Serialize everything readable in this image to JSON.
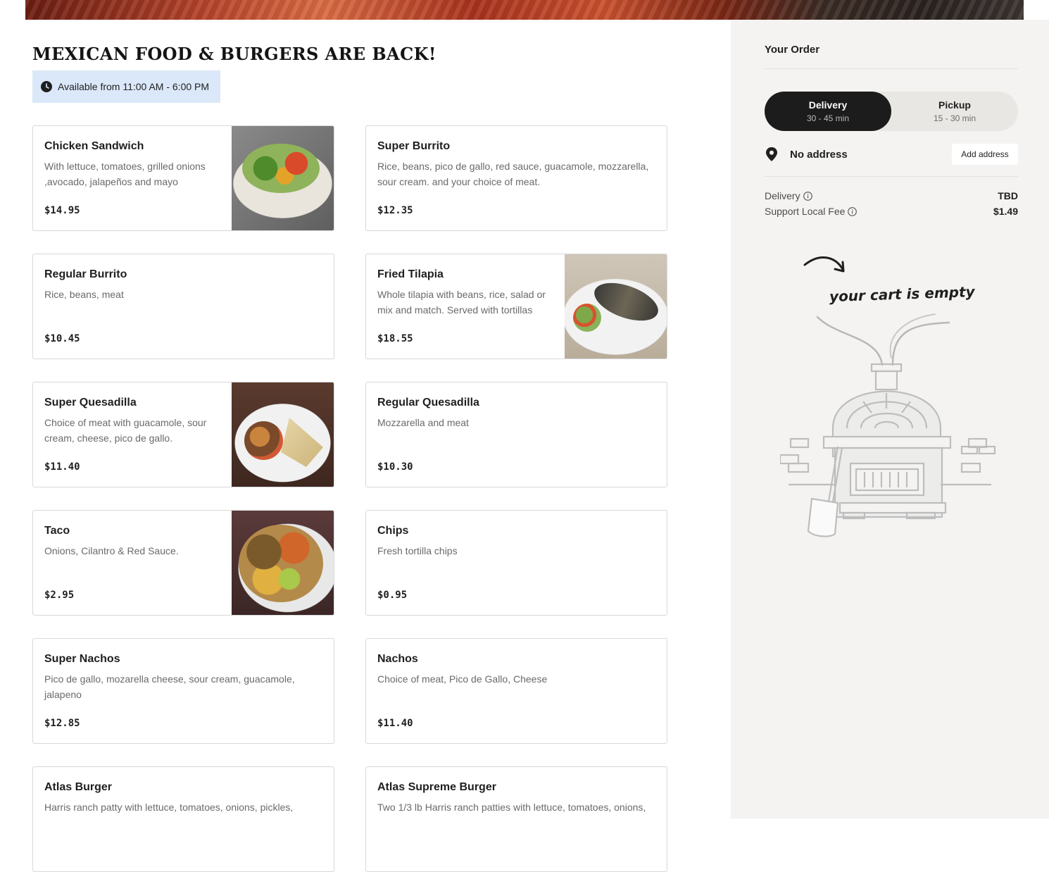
{
  "menu": {
    "title": "MEXICAN FOOD & BURGERS ARE BACK!",
    "availability": "Available from 11:00 AM - 6:00 PM",
    "items": [
      {
        "name": "Chicken Sandwich",
        "description": "With lettuce, tomatoes, grilled onions ,avocado, jalapeños and mayo",
        "price": "$14.95",
        "image": "chicken-sandwich-photo"
      },
      {
        "name": "Super Burrito",
        "description": "Rice, beans, pico de gallo, red sauce, guacamole, mozzarella, sour cream. and your choice of meat.",
        "price": "$12.35"
      },
      {
        "name": "Regular Burrito",
        "description": "Rice, beans, meat",
        "price": "$10.45"
      },
      {
        "name": "Fried Tilapia",
        "description": "Whole tilapia with beans, rice, salad or mix and match. Served with tortillas",
        "price": "$18.55",
        "image": "fried-tilapia-photo"
      },
      {
        "name": "Super Quesadilla",
        "description": "Choice of meat with guacamole, sour cream, cheese, pico de gallo.",
        "price": "$11.40",
        "image": "super-quesadilla-photo"
      },
      {
        "name": "Regular Quesadilla",
        "description": "Mozzarella and meat",
        "price": "$10.30"
      },
      {
        "name": "Taco",
        "description": "Onions, Cilantro & Red Sauce.",
        "price": "$2.95",
        "image": "taco-photo"
      },
      {
        "name": "Chips",
        "description": "Fresh tortilla chips",
        "price": "$0.95"
      },
      {
        "name": "Super Nachos",
        "description": "Pico de gallo, mozarella cheese, sour cream, guacamole, jalapeno",
        "price": "$12.85"
      },
      {
        "name": "Nachos",
        "description": "Choice of meat, Pico de Gallo, Cheese",
        "price": "$11.40"
      },
      {
        "name": "Atlas Burger",
        "description": "Harris ranch patty with lettuce, tomatoes, onions, pickles,",
        "price": ""
      },
      {
        "name": "Atlas Supreme Burger",
        "description": "Two 1/3 lb Harris ranch patties with lettuce, tomatoes, onions,",
        "price": ""
      }
    ]
  },
  "order": {
    "title": "Your Order",
    "delivery_option": {
      "label": "Delivery",
      "time": "30 - 45 min",
      "selected": true
    },
    "pickup_option": {
      "label": "Pickup",
      "time": "15 - 30 min",
      "selected": false
    },
    "address": {
      "text": "No address",
      "button": "Add address"
    },
    "fees": [
      {
        "label": "Delivery",
        "value": "TBD"
      },
      {
        "label": "Support Local Fee",
        "value": "$1.49"
      }
    ],
    "empty_cart_text": "your cart is empty"
  },
  "colors": {
    "availability_bg": "#dbe8f9",
    "sidebar_bg": "#f4f3f1",
    "toggle_active": "#1c1c1c"
  }
}
